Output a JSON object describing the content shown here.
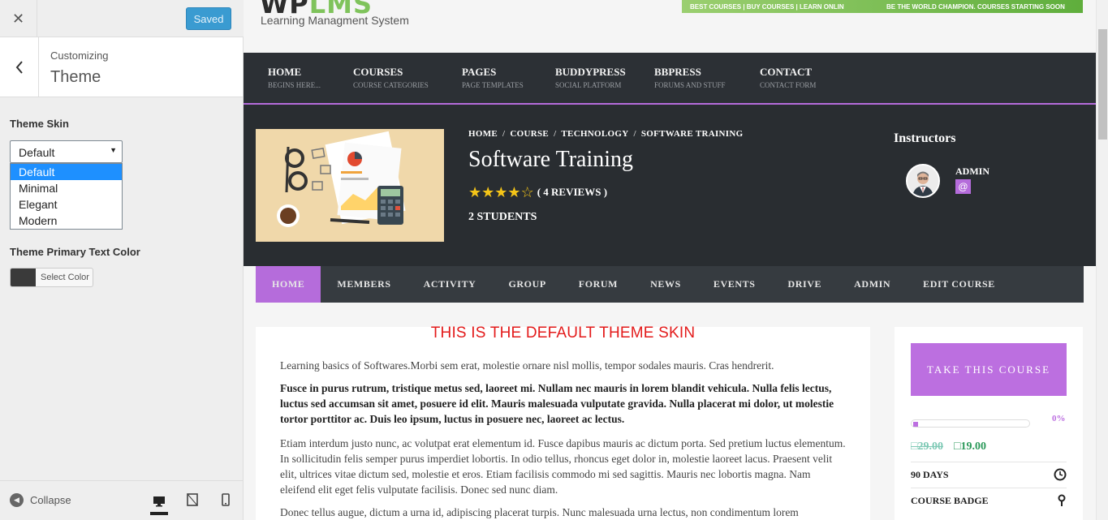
{
  "customizer": {
    "saved_label": "Saved",
    "subtitle": "Customizing",
    "title": "Theme",
    "skin_label": "Theme Skin",
    "skin_selected": "Default",
    "skin_options": [
      "Default",
      "Minimal",
      "Elegant",
      "Modern"
    ],
    "text_color_label": "Theme Primary Text Color",
    "select_color_label": "Select Color",
    "collapse_label": "Collapse"
  },
  "site": {
    "logo_main": "WP",
    "logo_accent": "LMS",
    "tagline": "Learning Managment System",
    "banner_left": "BEST COURSES | BUY COURSES | LEARN ONLINE",
    "banner_right": "BE THE WORLD CHAMPION. COURSES STARTING SOON",
    "nav": [
      {
        "label": "HOME",
        "sub": "BEGINS HERE..."
      },
      {
        "label": "COURSES",
        "sub": "COURSE CATEGORIES"
      },
      {
        "label": "PAGES",
        "sub": "PAGE TEMPLATES"
      },
      {
        "label": "BUDDYPRESS",
        "sub": "SOCIAL PLATFORM"
      },
      {
        "label": "BBPRESS",
        "sub": "FORUMS AND STUFF"
      },
      {
        "label": "CONTACT",
        "sub": "CONTACT FORM"
      }
    ],
    "breadcrumb": [
      "HOME",
      "COURSE",
      "TECHNOLOGY",
      "SOFTWARE TRAINING"
    ],
    "course_title": "Software Training",
    "rating": 4,
    "rating_max": 5,
    "reviews": "( 4 REVIEWS )",
    "students": "2 STUDENTS",
    "instructors_heading": "Instructors",
    "instructor_name": "ADMIN",
    "instructor_badge": "@",
    "tabs": [
      "HOME",
      "MEMBERS",
      "ACTIVITY",
      "GROUP",
      "FORUM",
      "NEWS",
      "EVENTS",
      "DRIVE",
      "ADMIN",
      "EDIT COURSE"
    ],
    "notice": "THIS IS THE DEFAULT THEME SKIN",
    "paragraphs": [
      "Learning basics of Softwares.Morbi sem erat, molestie ornare nisl mollis, tempor sodales mauris. Cras hendrerit.",
      "Fusce in purus rutrum, tristique metus sed, laoreet mi. Nullam nec mauris in lorem blandit vehicula. Nulla felis lectus, luctus sed accumsan sit amet, posuere id elit. Mauris malesuada vulputate gravida. Nulla placerat mi dolor, ut molestie tortor porttitor ac. Duis leo ipsum, luctus in posuere nec, laoreet ac lectus.",
      "Etiam interdum justo nunc, ac volutpat erat elementum id. Fusce dapibus mauris ac dictum porta. Sed pretium luctus elementum. In sollicitudin felis semper purus imperdiet lobortis. In odio tellus, rhoncus eget dolor in, molestie laoreet lacus. Praesent velit elit, ultrices vitae dictum sed, molestie et eros. Etiam facilisis commodo mi sed sagittis. Mauris nec lobortis magna. Nam eleifend elit eget felis vulputate facilisis. Donec sed nunc diam.",
      "Donec tellus augue, dictum a urna id, adipiscing placerat turpis. Nunc malesuada urna lectus, non condimentum lorem"
    ],
    "take_course": "TAKE THIS COURSE",
    "progress_pct": 0,
    "progress_label": "0%",
    "price_old": "□29.00",
    "price_new": "□19.00",
    "duration": "90 DAYS",
    "badge_label": "COURSE BADGE"
  },
  "colors": {
    "accent": "#b56cdb",
    "nav_bg": "#2c3035",
    "saved_button": "#3a9bd1"
  }
}
